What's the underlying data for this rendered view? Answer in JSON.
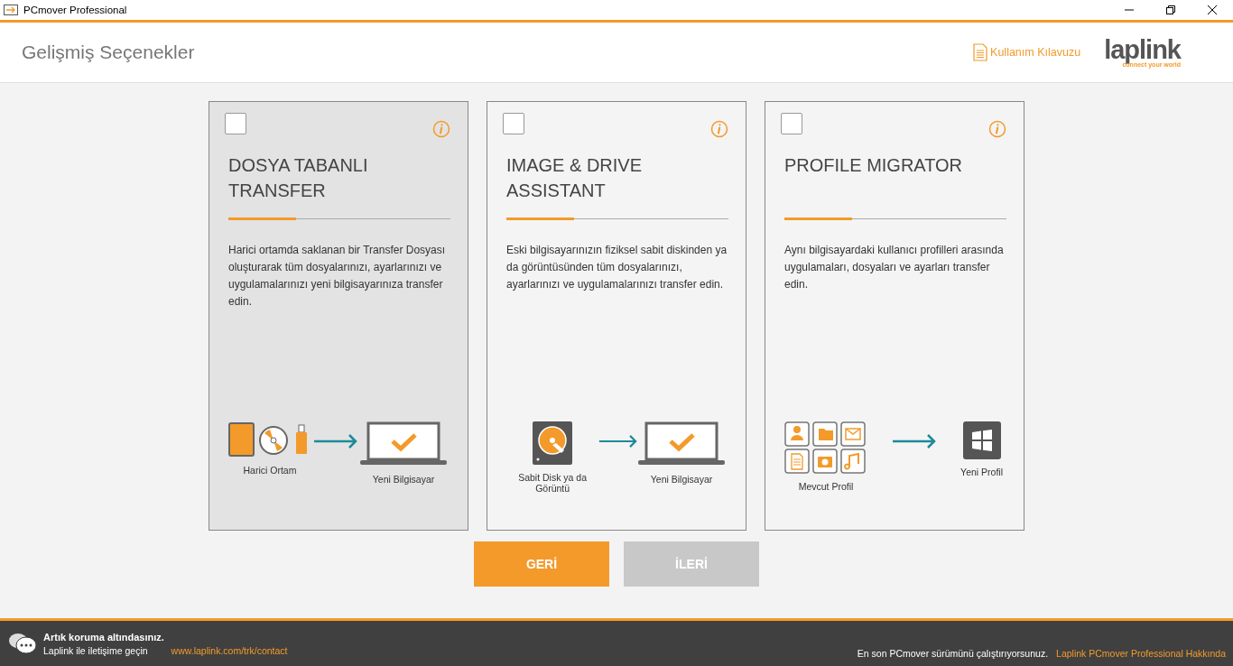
{
  "window": {
    "title": "PCmover Professional"
  },
  "header": {
    "title": "Gelişmiş Seçenekler",
    "guide_link": "Kullanım Kılavuzu",
    "logo": {
      "name": "laplink",
      "tagline": "connect your world"
    }
  },
  "cards": [
    {
      "title": "DOSYA TABANLI TRANSFER",
      "checked": false,
      "selected": true,
      "description": "Harici ortamda saklanan bir Transfer Dosyası oluşturarak tüm dosyalarınızı, ayarlarınızı ve uygulamalarınızı yeni bilgisayarınıza transfer edin.",
      "kind": "media",
      "source_label": "Harici Ortam",
      "target_label": "Yeni Bilgisayar"
    },
    {
      "title": "IMAGE & DRIVE ASSISTANT",
      "checked": false,
      "selected": false,
      "description": "Eski bilgisayarınızın fiziksel sabit diskinden ya da görüntüsünden tüm dosyalarınızı, ayarlarınızı ve uygulamalarınızı transfer edin.",
      "kind": "disk",
      "source_label": "Sabit Disk ya da Görüntü",
      "target_label": "Yeni Bilgisayar"
    },
    {
      "title": "PROFILE MIGRATOR",
      "checked": false,
      "selected": false,
      "description": "Aynı bilgisayardaki kullanıcı profilleri arasında uygulamaları, dosyaları ve ayarları transfer edin.",
      "kind": "profile",
      "source_label": "Mevcut Profil",
      "target_label": "Yeni Profil"
    }
  ],
  "buttons": [
    {
      "label": "GERİ",
      "disabled": false
    },
    {
      "label": "İLERİ",
      "disabled": true
    }
  ],
  "footer": {
    "status": "Artık koruma altındasınız.",
    "contact_text": "Laplink ile iletişime geçin",
    "contact_link": "www.laplink.com/trk/contact",
    "version_text": "En son PCmover sürümünü çalıştırıyorsunuz.",
    "about_link": "Laplink PCmover Professional Hakkında"
  }
}
